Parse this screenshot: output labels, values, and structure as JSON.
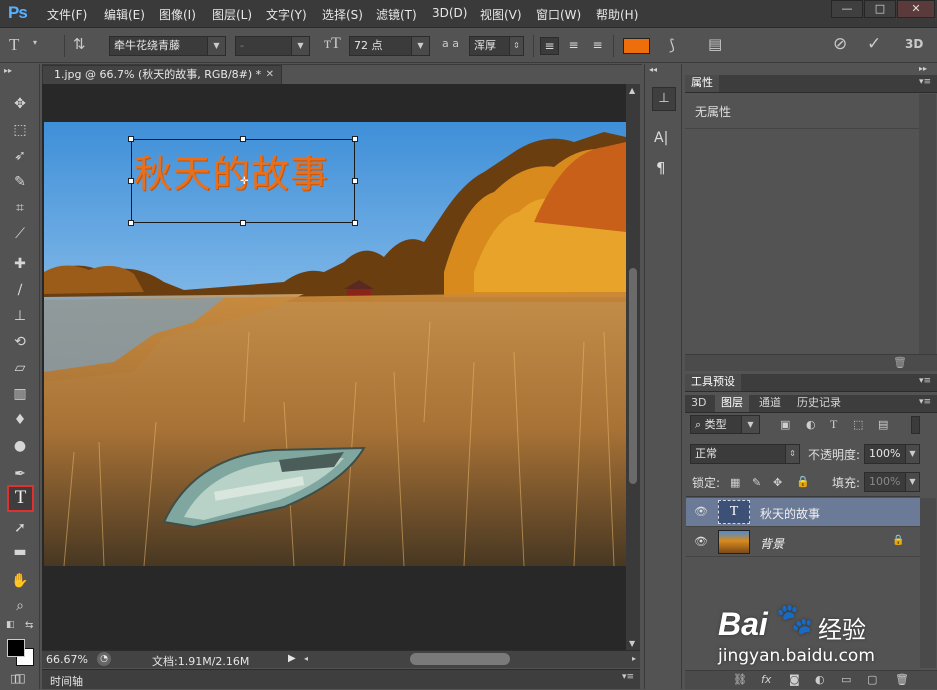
{
  "app": {
    "logo": "Ps"
  },
  "menu": [
    "文件(F)",
    "编辑(E)",
    "图像(I)",
    "图层(L)",
    "文字(Y)",
    "选择(S)",
    "滤镜(T)",
    "3D(D)",
    "视图(V)",
    "窗口(W)",
    "帮助(H)"
  ],
  "window_controls": {
    "minimize": "—",
    "maximize": "□",
    "close": "✕"
  },
  "options": {
    "font_family": "牵牛花绕青藤",
    "font_style": "-",
    "font_size": "72 点",
    "aa_label": "a a",
    "antialias": "浑厚",
    "text_color": "#ee6e0c"
  },
  "document": {
    "tab_title": "1.jpg @ 66.7% (秋天的故事, RGB/8#) *",
    "text_layer_content": "秋天的故事",
    "zoom": "66.67%",
    "doc_info": "文档:1.91M/2.16M",
    "timeline_label": "时间轴"
  },
  "properties_panel": {
    "tab": "属性",
    "empty_text": "无属性"
  },
  "tool_presets_panel": {
    "tab": "工具预设"
  },
  "layers_panel": {
    "tabs": [
      "3D",
      "图层",
      "通道",
      "历史记录"
    ],
    "active_tab": "图层",
    "filter_kind": "类型",
    "blend_mode": "正常",
    "opacity_label": "不透明度:",
    "opacity_value": "100%",
    "lock_label": "锁定:",
    "fill_label": "填充:",
    "fill_value": "100%",
    "layers": [
      {
        "name": "秋天的故事",
        "type": "text",
        "thumb": "T",
        "selected": true
      },
      {
        "name": "背景",
        "type": "image",
        "locked": true,
        "selected": false
      }
    ]
  },
  "watermark": {
    "brand": "Bai",
    "brand_cn": "经验",
    "url": "jingyan.baidu.com"
  }
}
